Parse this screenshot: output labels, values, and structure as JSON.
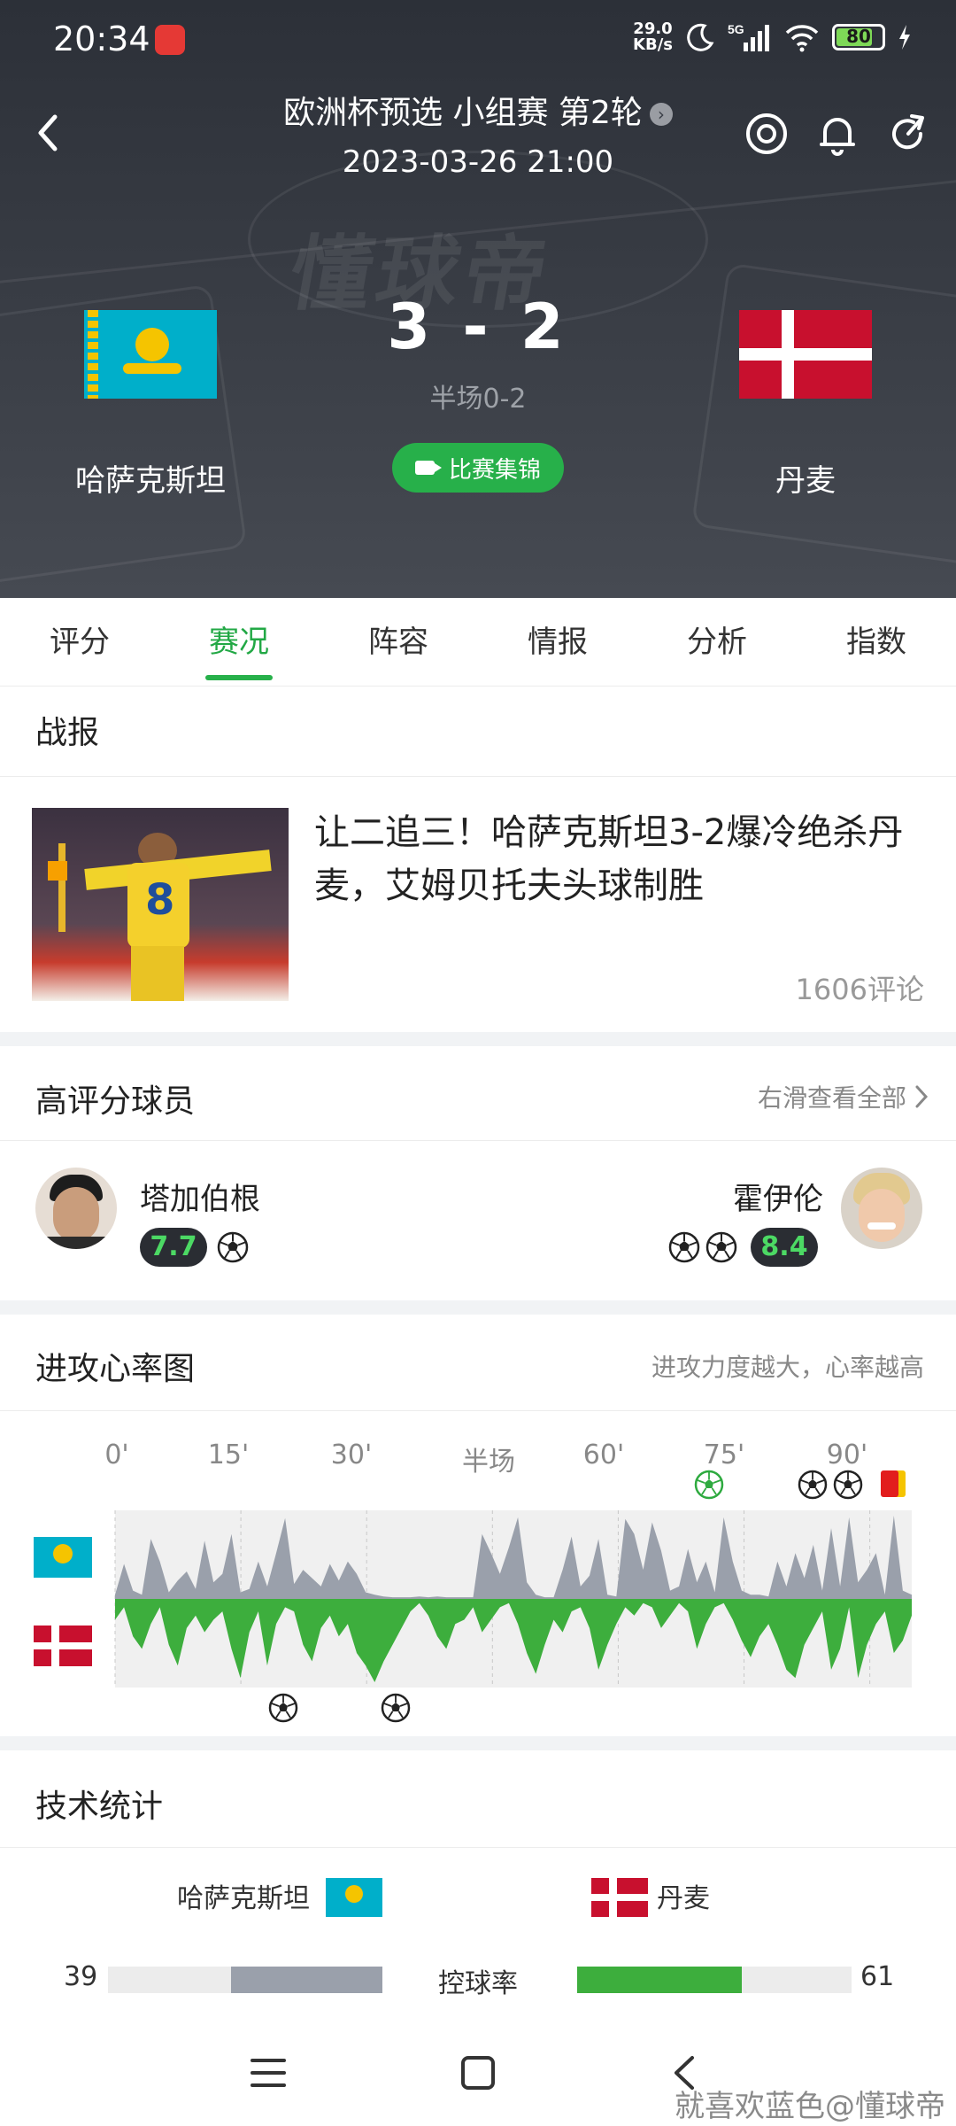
{
  "status_bar": {
    "time": "20:34",
    "net_speed_value": "29.0",
    "net_speed_unit": "KB/s",
    "network": "5G",
    "battery": "80"
  },
  "match": {
    "title": "欧洲杯预选 小组赛 第2轮",
    "datetime": "2023-03-26 21:00",
    "home_team": "哈萨克斯坦",
    "away_team": "丹麦",
    "score": "3 - 2",
    "halftime": "半场0-2",
    "highlights_label": "比赛集锦"
  },
  "tabs": [
    "评分",
    "赛况",
    "阵容",
    "情报",
    "分析",
    "指数"
  ],
  "active_tab": "赛况",
  "report": {
    "section_title": "战报",
    "headline": "让二追三！哈萨克斯坦3-2爆冷绝杀丹麦，艾姆贝托夫头球制胜",
    "comments": "1606评论",
    "image_jersey_number": "8"
  },
  "top_players": {
    "section_title": "高评分球员",
    "see_all": "右滑查看全部",
    "home": {
      "name": "塔加伯根",
      "rating": "7.7",
      "goals": 1
    },
    "away": {
      "name": "霍伊伦",
      "rating": "8.4",
      "goals": 2
    }
  },
  "heartrate": {
    "section_title": "进攻心率图",
    "hint": "进攻力度越大，心率越高",
    "time_labels": [
      "0'",
      "15'",
      "30'",
      "半场",
      "60'",
      "75'",
      "90'"
    ],
    "home_series": [
      0.05,
      0.42,
      0.1,
      0.05,
      0.72,
      0.45,
      0.08,
      0.22,
      0.33,
      0.12,
      0.7,
      0.2,
      0.3,
      0.78,
      0.08,
      0.12,
      0.45,
      0.15,
      0.55,
      0.97,
      0.18,
      0.35,
      0.25,
      0.15,
      0.42,
      0.22,
      0.45,
      0.3,
      0.08,
      0.05,
      0.03,
      0.02,
      0.02,
      0.02,
      0.03,
      0.02,
      0.03,
      0.02,
      0.02,
      0.02,
      0.02,
      0.78,
      0.55,
      0.3,
      0.62,
      0.98,
      0.2,
      0.05,
      0.02,
      0.02,
      0.35,
      0.75,
      0.15,
      0.28,
      0.72,
      0.05,
      0.03,
      0.96,
      0.78,
      0.35,
      0.92,
      0.58,
      0.1,
      0.15,
      0.6,
      0.2,
      0.45,
      0.08,
      0.98,
      0.45,
      0.1,
      0.05,
      0.05,
      0.03,
      0.45,
      0.15,
      0.55,
      0.25,
      0.65,
      0.1,
      0.85,
      0.15,
      0.98,
      0.2,
      0.35,
      0.55,
      0.05,
      1.0,
      0.1,
      0.05
    ],
    "away_series": [
      0.25,
      0.1,
      0.45,
      0.6,
      0.3,
      0.1,
      0.55,
      0.8,
      0.35,
      0.2,
      0.4,
      0.25,
      0.15,
      0.6,
      0.95,
      0.4,
      0.15,
      0.8,
      0.3,
      0.1,
      0.15,
      0.55,
      0.75,
      0.35,
      0.2,
      0.45,
      0.3,
      0.65,
      0.8,
      1.0,
      0.75,
      0.55,
      0.35,
      0.15,
      0.05,
      0.2,
      0.45,
      0.6,
      0.3,
      0.25,
      0.1,
      0.4,
      0.25,
      0.1,
      0.05,
      0.3,
      0.65,
      0.9,
      0.55,
      0.25,
      0.4,
      0.15,
      0.1,
      0.35,
      0.85,
      0.55,
      0.3,
      0.1,
      0.2,
      0.05,
      0.1,
      0.35,
      0.2,
      0.05,
      0.15,
      0.6,
      0.3,
      0.1,
      0.05,
      0.25,
      0.5,
      0.7,
      0.45,
      0.3,
      0.55,
      0.85,
      0.95,
      0.55,
      0.35,
      0.15,
      0.85,
      0.6,
      0.1,
      0.95,
      0.55,
      0.3,
      0.15,
      0.65,
      0.5,
      0.2
    ]
  },
  "stats": {
    "section_title": "技术统计",
    "home_team": "哈萨克斯坦",
    "away_team": "丹麦",
    "rows": [
      {
        "label": "控球率",
        "home": 39,
        "away": 61
      }
    ]
  },
  "credit": "就喜欢蓝色@懂球帝",
  "colors": {
    "accent": "#27b04a",
    "header_bg": "#2f3339",
    "home_bar": "#9aa0ab",
    "away_bar": "#3dae3d"
  }
}
